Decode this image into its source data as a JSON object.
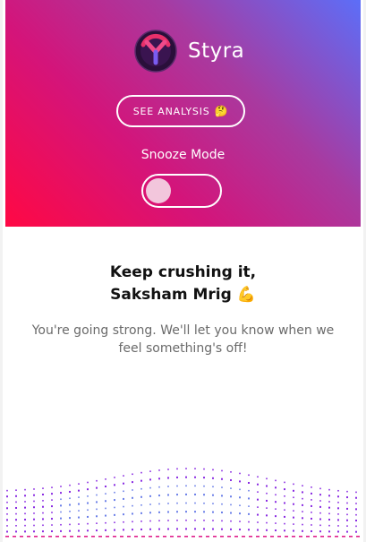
{
  "app": {
    "brand_name": "Styra",
    "logo_icon": "styra-logo-icon"
  },
  "hero": {
    "analysis_button": {
      "label": "SEE ANALYSIS",
      "emoji": "🤔"
    },
    "snooze": {
      "label": "Snooze Mode",
      "enabled": false
    },
    "gradient_colors": [
      "#ff0844",
      "#d4147a",
      "#a83aa0",
      "#5c6ef8"
    ]
  },
  "content": {
    "greeting_line1": "Keep crushing it,",
    "greeting_line2": "Saksham Mrig",
    "greeting_emoji": "💪",
    "message": "You're going strong. We'll let you know when we feel something's off!"
  },
  "decoration": {
    "wave_colors": [
      "#8a2be2",
      "#6b7fe8",
      "#e0208c"
    ]
  }
}
